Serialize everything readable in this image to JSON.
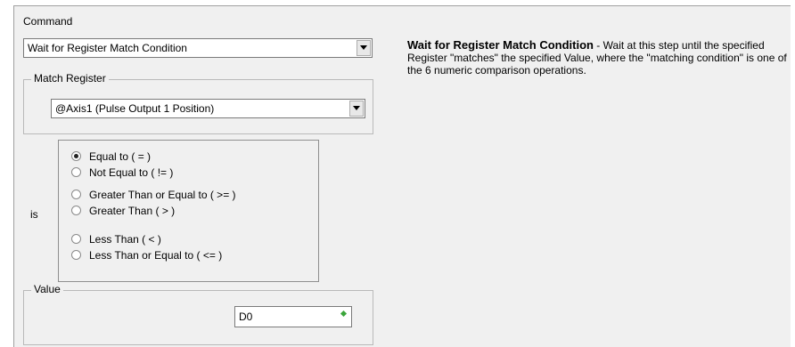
{
  "command": {
    "label": "Command",
    "selected": "Wait for Register Match Condition"
  },
  "match_register": {
    "legend": "Match Register",
    "selected": "@Axis1 (Pulse Output 1 Position)"
  },
  "is_label": "is",
  "conditions": [
    {
      "label": "Equal to ( = )",
      "selected": true
    },
    {
      "label": "Not Equal to ( != )",
      "selected": false
    },
    {
      "label": "Greater Than or Equal to ( >= )",
      "selected": false
    },
    {
      "label": "Greater Than ( > )",
      "selected": false
    },
    {
      "label": "Less Than ( < )",
      "selected": false
    },
    {
      "label": "Less Than or Equal to ( <= )",
      "selected": false
    }
  ],
  "value": {
    "legend": "Value",
    "input": "D0"
  },
  "description": {
    "title": "Wait for Register Match Condition",
    "body": " - Wait at this step until the specified Register \"matches\" the specified Value, where the \"matching condition\" is one of the 6 numeric comparison operations."
  },
  "colors": {
    "panel_bg": "#f0f0f0",
    "indicator": "#3aa53a"
  }
}
